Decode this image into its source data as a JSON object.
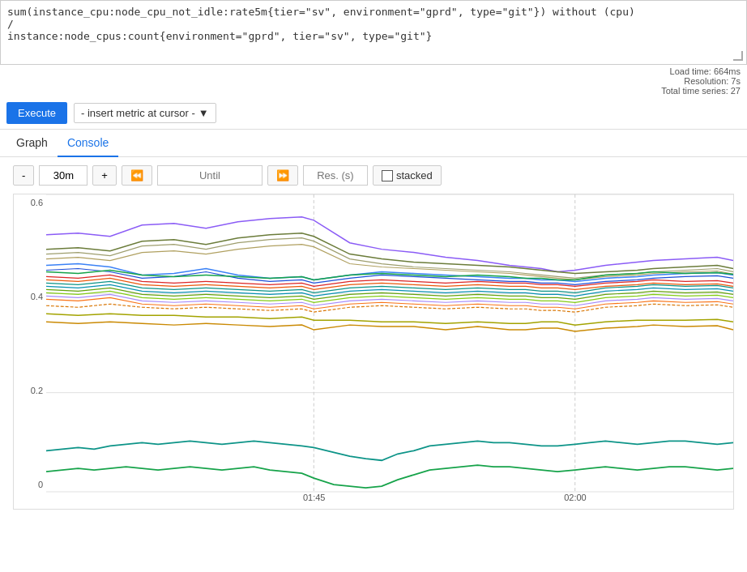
{
  "query": {
    "line1": "sum(instance_cpu:node_cpu_not_idle:rate5m{tier=\"sv\", environment=\"gprd\", type=\"git\"}) without (cpu)",
    "line2": "  /",
    "line3": "instance:node_cpus:count{environment=\"gprd\", tier=\"sv\", type=\"git\"}"
  },
  "stats": {
    "load_time": "Load time: 664ms",
    "resolution": "Resolution: 7s",
    "total_time_series": "Total time series: 27"
  },
  "toolbar": {
    "execute_label": "Execute",
    "insert_metric_label": "- insert metric at cursor -"
  },
  "tabs": {
    "graph_label": "Graph",
    "console_label": "Console"
  },
  "controls": {
    "minus": "-",
    "range": "30m",
    "plus": "+",
    "rewind": "«",
    "until_placeholder": "Until",
    "forward": "»",
    "res_placeholder": "Res. (s)",
    "stacked_label": "stacked"
  },
  "chart": {
    "y_labels": [
      "0.6",
      "0.4",
      "0.2",
      "0"
    ],
    "x_labels": [
      {
        "label": "01:45",
        "pct": 39
      },
      {
        "label": "02:00",
        "pct": 77
      }
    ]
  }
}
